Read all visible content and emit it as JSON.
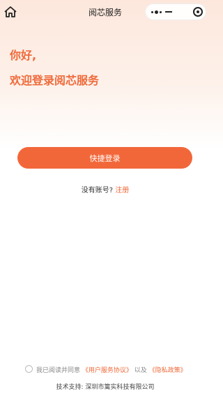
{
  "nav": {
    "title": "阅芯服务",
    "icons": {
      "home": "home-icon",
      "more": "more-dots-icon",
      "minimize": "minimize-icon",
      "close": "close-target-icon"
    }
  },
  "greeting": {
    "line1": "你好,",
    "line2": "欢迎登录阅芯服务"
  },
  "login": {
    "button_label": "快捷登录"
  },
  "register": {
    "prompt": "没有账号?",
    "link": "注册"
  },
  "agreement": {
    "prefix": "我已阅读并同意",
    "user_agreement": "《用户服务协议》",
    "joiner": "以及",
    "privacy_policy": "《隐私政策》"
  },
  "footer": {
    "support": "技术支持: 深圳市篱实科技有限公司"
  },
  "colors": {
    "accent": "#f2673a",
    "accent_text": "#ef6a3a"
  }
}
